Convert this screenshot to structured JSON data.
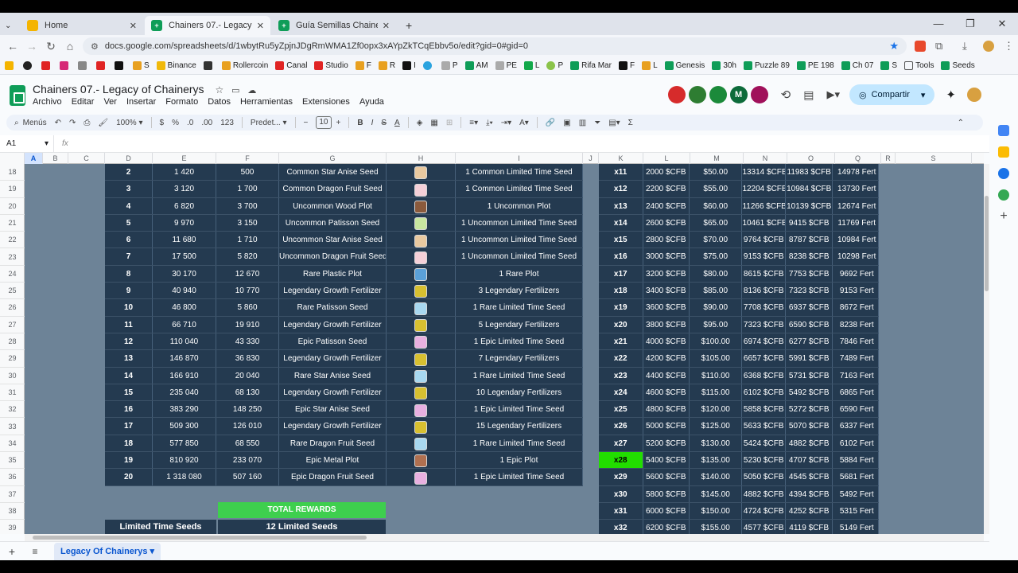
{
  "browser": {
    "tabs": [
      {
        "title": "Home",
        "active": false,
        "icon_color": "#f4b400"
      },
      {
        "title": "Chainers 07.- Legacy of Chaine",
        "active": true,
        "icon_color": "#0f9d58"
      },
      {
        "title": "Guía Semillas Chainers by Pierc",
        "active": false,
        "icon_color": "#0f9d58"
      }
    ],
    "new_tab": "+",
    "url": "docs.google.com/spreadsheets/d/1wbytRu5yZpjnJDgRmWMA1Zf0opx3xAYpZkTCqEbbv5o/edit?gid=0#gid=0",
    "bookmarks": [
      "S",
      "Binance",
      "Rollercoin",
      "Canal",
      "Studio",
      "F",
      "R",
      "I",
      "P",
      "AM",
      "PE",
      "L",
      "P",
      "Rifa Mar",
      "F",
      "L",
      "Genesis",
      "30h",
      "Puzzle 89",
      "PE 198",
      "Ch 07",
      "S",
      "Tools",
      "Seeds"
    ]
  },
  "doc": {
    "title": "Chainers 07.- Legacy of Chainerys",
    "menus": [
      "Archivo",
      "Editar",
      "Ver",
      "Insertar",
      "Formato",
      "Datos",
      "Herramientas",
      "Extensiones",
      "Ayuda"
    ],
    "share_label": "Compartir",
    "avatar_m": "M"
  },
  "toolbar": {
    "menus_label": "Menús",
    "zoom": "100%",
    "currency": "$",
    "percent": "%",
    "dec_less": ".0",
    "dec_more": ".00",
    "num_format": "123",
    "font": "Predet...",
    "font_size": "10",
    "bold": "B",
    "italic": "I",
    "sigma": "Σ"
  },
  "formula_bar": {
    "cell": "A1",
    "fx": "fx"
  },
  "columns": [
    "A",
    "B",
    "C",
    "D",
    "E",
    "F",
    "G",
    "H",
    "I",
    "J",
    "K",
    "L",
    "M",
    "N",
    "O",
    "Q",
    "R",
    "S"
  ],
  "row_numbers": [
    "18",
    "19",
    "20",
    "21",
    "22",
    "23",
    "24",
    "25",
    "26",
    "27",
    "28",
    "29",
    "30",
    "31",
    "32",
    "33",
    "34",
    "35",
    "36",
    "37",
    "38",
    "39"
  ],
  "levels_table": [
    {
      "d": "2",
      "e": "1 420",
      "f": "500",
      "g": "Common Star Anise Seed",
      "seed": "#e9c9a0",
      "i": "1 Common Limited Time Seed"
    },
    {
      "d": "3",
      "e": "3 120",
      "f": "1 700",
      "g": "Common Dragon Fruit Seed",
      "seed": "#f5d0d8",
      "i": "1 Common Limited Time Seed"
    },
    {
      "d": "4",
      "e": "6 820",
      "f": "3 700",
      "g": "Uncommon Wood Plot",
      "seed": "#8a5a3c",
      "i": "1 Uncommon Plot"
    },
    {
      "d": "5",
      "e": "9 970",
      "f": "3 150",
      "g": "Uncommon Patisson Seed",
      "seed": "#c8e6a0",
      "i": "1 Uncommon Limited Time Seed"
    },
    {
      "d": "6",
      "e": "11 680",
      "f": "1 710",
      "g": "Uncommon Star Anise Seed",
      "seed": "#e9c9a0",
      "i": "1 Uncommon Limited Time Seed"
    },
    {
      "d": "7",
      "e": "17 500",
      "f": "5 820",
      "g": "Uncommon Dragon Fruit Seed",
      "seed": "#f5d0d8",
      "i": "1 Uncommon Limited Time Seed"
    },
    {
      "d": "8",
      "e": "30 170",
      "f": "12 670",
      "g": "Rare Plastic Plot",
      "seed": "#5aa0d8",
      "i": "1 Rare Plot"
    },
    {
      "d": "9",
      "e": "40 940",
      "f": "10 770",
      "g": "Legendary Growth Fertilizer",
      "seed": "#d8c030",
      "i": "3 Legendary Fertilizers"
    },
    {
      "d": "10",
      "e": "46 800",
      "f": "5 860",
      "g": "Rare Patisson Seed",
      "seed": "#a8d8f0",
      "i": "1 Rare Limited Time Seed"
    },
    {
      "d": "11",
      "e": "66 710",
      "f": "19 910",
      "g": "Legendary Growth Fertilizer",
      "seed": "#d8c030",
      "i": "5 Legendary Fertilizers"
    },
    {
      "d": "12",
      "e": "110 040",
      "f": "43 330",
      "g": "Epic Patisson Seed",
      "seed": "#e8b0e0",
      "i": "1 Epic Limited Time Seed"
    },
    {
      "d": "13",
      "e": "146 870",
      "f": "36 830",
      "g": "Legendary Growth Fertilizer",
      "seed": "#d8c030",
      "i": "7 Legendary Fertilizers"
    },
    {
      "d": "14",
      "e": "166 910",
      "f": "20 040",
      "g": "Rare Star Anise Seed",
      "seed": "#a8d8f0",
      "i": "1 Rare Limited Time Seed"
    },
    {
      "d": "15",
      "e": "235 040",
      "f": "68 130",
      "g": "Legendary Growth Fertilizer",
      "seed": "#d8c030",
      "i": "10 Legendary Fertilizers"
    },
    {
      "d": "16",
      "e": "383 290",
      "f": "148 250",
      "g": "Epic Star Anise Seed",
      "seed": "#e8b0e0",
      "i": "1 Epic Limited Time Seed"
    },
    {
      "d": "17",
      "e": "509 300",
      "f": "126 010",
      "g": "Legendary Growth Fertilizer",
      "seed": "#d8c030",
      "i": "15 Legendary Fertilizers"
    },
    {
      "d": "18",
      "e": "577 850",
      "f": "68 550",
      "g": "Rare Dragon Fruit Seed",
      "seed": "#a8d8f0",
      "i": "1 Rare Limited Time Seed"
    },
    {
      "d": "19",
      "e": "810 920",
      "f": "233 070",
      "g": "Epic Metal Plot",
      "seed": "#b07050",
      "i": "1 Epic Plot"
    },
    {
      "d": "20",
      "e": "1 318 080",
      "f": "507 160",
      "g": "Epic Dragon Fruit Seed",
      "seed": "#e8b0e0",
      "i": "1 Epic Limited Time Seed"
    }
  ],
  "multiplier_table": [
    {
      "k": "x11",
      "l": "2000 $CFB",
      "m": "$50.00",
      "n": "13314 $CFB",
      "o": "11983 $CFB",
      "q": "14978 Fert"
    },
    {
      "k": "x12",
      "l": "2200 $CFB",
      "m": "$55.00",
      "n": "12204 $CFB",
      "o": "10984 $CFB",
      "q": "13730 Fert"
    },
    {
      "k": "x13",
      "l": "2400 $CFB",
      "m": "$60.00",
      "n": "11266 $CFB",
      "o": "10139 $CFB",
      "q": "12674 Fert"
    },
    {
      "k": "x14",
      "l": "2600 $CFB",
      "m": "$65.00",
      "n": "10461 $CFB",
      "o": "9415 $CFB",
      "q": "11769 Fert"
    },
    {
      "k": "x15",
      "l": "2800 $CFB",
      "m": "$70.00",
      "n": "9764 $CFB",
      "o": "8787 $CFB",
      "q": "10984 Fert"
    },
    {
      "k": "x16",
      "l": "3000 $CFB",
      "m": "$75.00",
      "n": "9153 $CFB",
      "o": "8238 $CFB",
      "q": "10298 Fert"
    },
    {
      "k": "x17",
      "l": "3200 $CFB",
      "m": "$80.00",
      "n": "8615 $CFB",
      "o": "7753 $CFB",
      "q": "9692 Fert"
    },
    {
      "k": "x18",
      "l": "3400 $CFB",
      "m": "$85.00",
      "n": "8136 $CFB",
      "o": "7323 $CFB",
      "q": "9153 Fert"
    },
    {
      "k": "x19",
      "l": "3600 $CFB",
      "m": "$90.00",
      "n": "7708 $CFB",
      "o": "6937 $CFB",
      "q": "8672 Fert"
    },
    {
      "k": "x20",
      "l": "3800 $CFB",
      "m": "$95.00",
      "n": "7323 $CFB",
      "o": "6590 $CFB",
      "q": "8238 Fert"
    },
    {
      "k": "x21",
      "l": "4000 $CFB",
      "m": "$100.00",
      "n": "6974 $CFB",
      "o": "6277 $CFB",
      "q": "7846 Fert"
    },
    {
      "k": "x22",
      "l": "4200 $CFB",
      "m": "$105.00",
      "n": "6657 $CFB",
      "o": "5991 $CFB",
      "q": "7489 Fert"
    },
    {
      "k": "x23",
      "l": "4400 $CFB",
      "m": "$110.00",
      "n": "6368 $CFB",
      "o": "5731 $CFB",
      "q": "7163 Fert"
    },
    {
      "k": "x24",
      "l": "4600 $CFB",
      "m": "$115.00",
      "n": "6102 $CFB",
      "o": "5492 $CFB",
      "q": "6865 Fert"
    },
    {
      "k": "x25",
      "l": "4800 $CFB",
      "m": "$120.00",
      "n": "5858 $CFB",
      "o": "5272 $CFB",
      "q": "6590 Fert"
    },
    {
      "k": "x26",
      "l": "5000 $CFB",
      "m": "$125.00",
      "n": "5633 $CFB",
      "o": "5070 $CFB",
      "q": "6337 Fert"
    },
    {
      "k": "x27",
      "l": "5200 $CFB",
      "m": "$130.00",
      "n": "5424 $CFB",
      "o": "4882 $CFB",
      "q": "6102 Fert"
    },
    {
      "k": "x28",
      "l": "5400 $CFB",
      "m": "$135.00",
      "n": "5230 $CFB",
      "o": "4707 $CFB",
      "q": "5884 Fert",
      "highlight": true
    },
    {
      "k": "x29",
      "l": "5600 $CFB",
      "m": "$140.00",
      "n": "5050 $CFB",
      "o": "4545 $CFB",
      "q": "5681 Fert"
    },
    {
      "k": "x30",
      "l": "5800 $CFB",
      "m": "$145.00",
      "n": "4882 $CFB",
      "o": "4394 $CFB",
      "q": "5492 Fert"
    },
    {
      "k": "x31",
      "l": "6000 $CFB",
      "m": "$150.00",
      "n": "4724 $CFB",
      "o": "4252 $CFB",
      "q": "5315 Fert"
    },
    {
      "k": "x32",
      "l": "6200 $CFB",
      "m": "$155.00",
      "n": "4577 $CFB",
      "o": "4119 $CFB",
      "q": "5149 Fert"
    }
  ],
  "summary": {
    "total_rewards": "TOTAL REWARDS",
    "limited_label": "Limited Time Seeds",
    "limited_value": "12 Limited Seeds"
  },
  "watermark": "PIERO",
  "sheet_tab": "Legacy Of Chainerys"
}
